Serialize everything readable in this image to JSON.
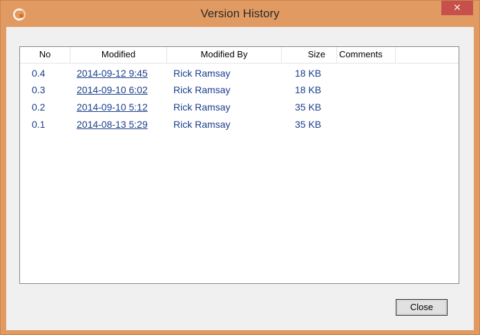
{
  "window": {
    "title": "Version History",
    "close_glyph": "×",
    "accent_color": "#e19a62",
    "close_color": "#c7504a"
  },
  "list": {
    "columns": [
      "No",
      "Modified",
      "Modified By",
      "Size",
      "Comments"
    ],
    "rows": [
      {
        "no": "0.4",
        "modified": "2014-09-12 9:45",
        "modified_by": "Rick Ramsay",
        "size": "18 KB",
        "comments": ""
      },
      {
        "no": "0.3",
        "modified": "2014-09-10 6:02",
        "modified_by": "Rick Ramsay",
        "size": "18 KB",
        "comments": ""
      },
      {
        "no": "0.2",
        "modified": "2014-09-10 5:12",
        "modified_by": "Rick Ramsay",
        "size": "35 KB",
        "comments": ""
      },
      {
        "no": "0.1",
        "modified": "2014-08-13 5:29",
        "modified_by": "Rick Ramsay",
        "size": "35 KB",
        "comments": ""
      }
    ]
  },
  "buttons": {
    "close_label": "Close"
  },
  "icons": {
    "app": "app-logo-icon",
    "close": "close-icon"
  }
}
